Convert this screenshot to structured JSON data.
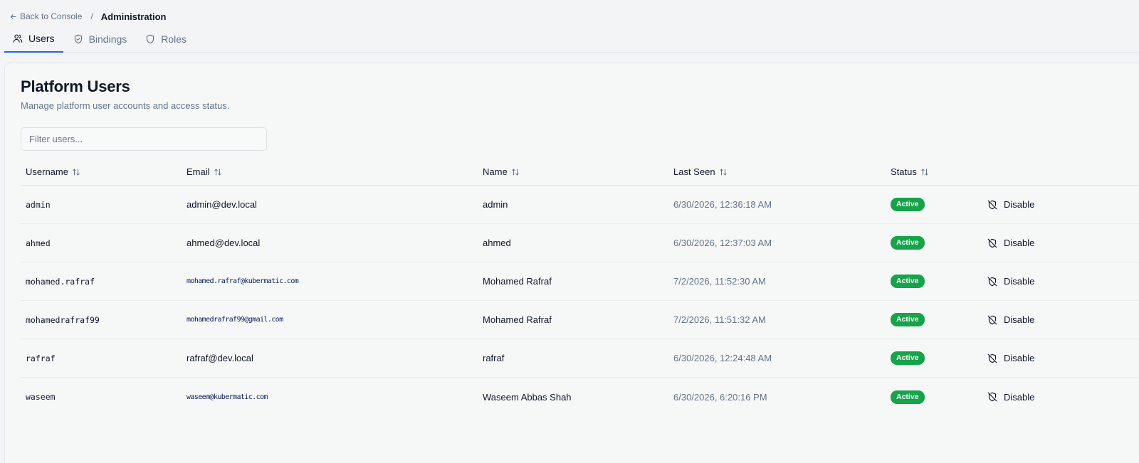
{
  "breadcrumb": {
    "back_label": "Back to Console",
    "separator": "/",
    "current": "Administration"
  },
  "tabs": [
    {
      "label": "Users",
      "icon": "users-icon",
      "active": true
    },
    {
      "label": "Bindings",
      "icon": "shield-check-icon",
      "active": false
    },
    {
      "label": "Roles",
      "icon": "shield-icon",
      "active": false
    }
  ],
  "page": {
    "title": "Platform Users",
    "subtitle": "Manage platform user accounts and access status.",
    "filter_placeholder": "Filter users..."
  },
  "table": {
    "columns": [
      "Username",
      "Email",
      "Name",
      "Last Seen",
      "Status"
    ],
    "action_label": "Disable",
    "rows": [
      {
        "username": "admin",
        "email": "admin@dev.local",
        "name": "admin",
        "last_seen": "6/30/2026, 12:36:18 AM",
        "status": "Active"
      },
      {
        "username": "ahmed",
        "email": "ahmed@dev.local",
        "name": "ahmed",
        "last_seen": "6/30/2026, 12:37:03 AM",
        "status": "Active"
      },
      {
        "username": "mohamed.rafraf",
        "email": "mohamed.rafraf@kubermatic.com",
        "name": "Mohamed Rafraf",
        "last_seen": "7/2/2026, 11:52:30 AM",
        "status": "Active"
      },
      {
        "username": "mohamedrafraf99",
        "email": "mohamedrafraf99@gmail.com",
        "name": "Mohamed Rafraf",
        "last_seen": "7/2/2026, 11:51:32 AM",
        "status": "Active"
      },
      {
        "username": "rafraf",
        "email": "rafraf@dev.local",
        "name": "rafraf",
        "last_seen": "6/30/2026, 12:24:48 AM",
        "status": "Active"
      },
      {
        "username": "waseem",
        "email": "waseem@kubermatic.com",
        "name": "Waseem Abbas Shah",
        "last_seen": "6/30/2026, 6:20:16 PM",
        "status": "Active"
      }
    ]
  },
  "colors": {
    "accent": "#2563eb",
    "status_active": "#16a34a",
    "muted_text": "#64748b"
  }
}
